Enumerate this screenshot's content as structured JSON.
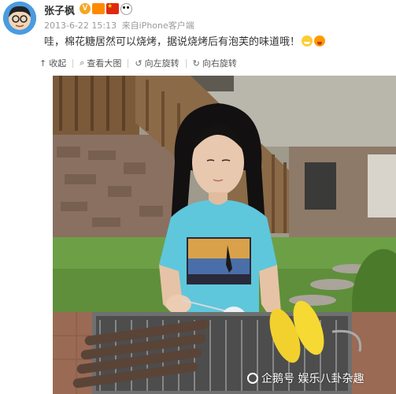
{
  "post": {
    "username": "张子枫",
    "verified_icon": "verified-v-icon",
    "badges": [
      "verified-v-icon",
      "happy-birthday-badge-icon",
      "china-flag-icon",
      "panda-icon"
    ],
    "date": "2013-6-22 15:13",
    "source_prefix": "来自",
    "source": "iPhone客户端",
    "text": "哇，棉花糖居然可以烧烤，据说烧烤后有泡芙的味道哦！",
    "text_emojis": [
      "grin-emoji-icon",
      "laugh-emoji-icon"
    ]
  },
  "actions": {
    "collapse": {
      "icon": "arrow-up-icon",
      "label": "收起"
    },
    "view_large": {
      "icon": "magnify-icon",
      "label": "查看大图"
    },
    "rotate_left": {
      "icon": "rotate-left-icon",
      "label": "向左旋转"
    },
    "rotate_right": {
      "icon": "rotate-right-icon",
      "label": "向右旋转"
    }
  },
  "watermark": {
    "icon": "sohu-logo-icon",
    "text": "企鹅号 娱乐八卦杂趣"
  }
}
